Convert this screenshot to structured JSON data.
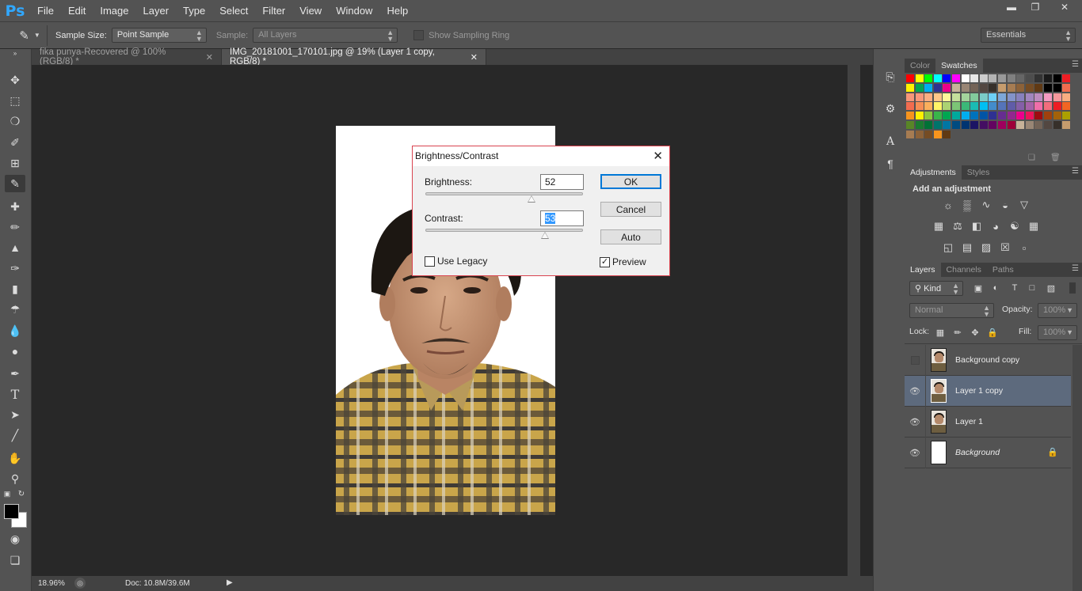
{
  "app": {
    "logo": "Ps",
    "menu": [
      "File",
      "Edit",
      "Image",
      "Layer",
      "Type",
      "Select",
      "Filter",
      "View",
      "Window",
      "Help"
    ],
    "window_controls": [
      "minimize-icon",
      "restore-icon",
      "close-icon"
    ]
  },
  "options_bar": {
    "sample_size_label": "Sample Size:",
    "sample_size_value": "Point Sample",
    "sample_label": "Sample:",
    "sample_value": "All Layers",
    "show_sampling_ring": "Show Sampling Ring",
    "workspace": "Essentials"
  },
  "tabs": [
    {
      "label": "fika punya-Recovered @ 100% (RGB/8) *",
      "active": false
    },
    {
      "label": "IMG_20181001_170101.jpg @ 19% (Layer 1 copy, RGB/8) *",
      "active": true
    }
  ],
  "status": {
    "zoom": "18.96%",
    "doc": "Doc: 10.8M/39.6M"
  },
  "color_panel": {
    "tabs": [
      "Color",
      "Swatches"
    ],
    "active_tab": "Swatches"
  },
  "adjustments_panel": {
    "tabs": [
      "Adjustments",
      "Styles"
    ],
    "heading": "Add an adjustment"
  },
  "layers_panel": {
    "tabs": [
      "Layers",
      "Channels",
      "Paths"
    ],
    "filter_kind": "Kind",
    "blend_mode": "Normal",
    "opacity_label": "Opacity:",
    "opacity_value": "100%",
    "lock_label": "Lock:",
    "fill_label": "Fill:",
    "fill_value": "100%",
    "layers": [
      {
        "name": "Background copy",
        "visible": false,
        "selected": false
      },
      {
        "name": "Layer 1 copy",
        "visible": true,
        "selected": true
      },
      {
        "name": "Layer 1",
        "visible": true,
        "selected": false
      },
      {
        "name": "Background",
        "visible": true,
        "selected": false,
        "locked": true
      }
    ]
  },
  "dialog": {
    "title": "Brightness/Contrast",
    "brightness_label": "Brightness:",
    "brightness_value": "52",
    "contrast_label": "Contrast:",
    "contrast_value": "53",
    "use_legacy_label": "Use Legacy",
    "use_legacy_checked": false,
    "preview_label": "Preview",
    "preview_checked": true,
    "ok_label": "OK",
    "cancel_label": "Cancel",
    "auto_label": "Auto"
  },
  "colors": {
    "accent": "#31a8ff",
    "dialog_border": "#d9434f",
    "foreground": "#000000",
    "background": "#ffffff"
  }
}
